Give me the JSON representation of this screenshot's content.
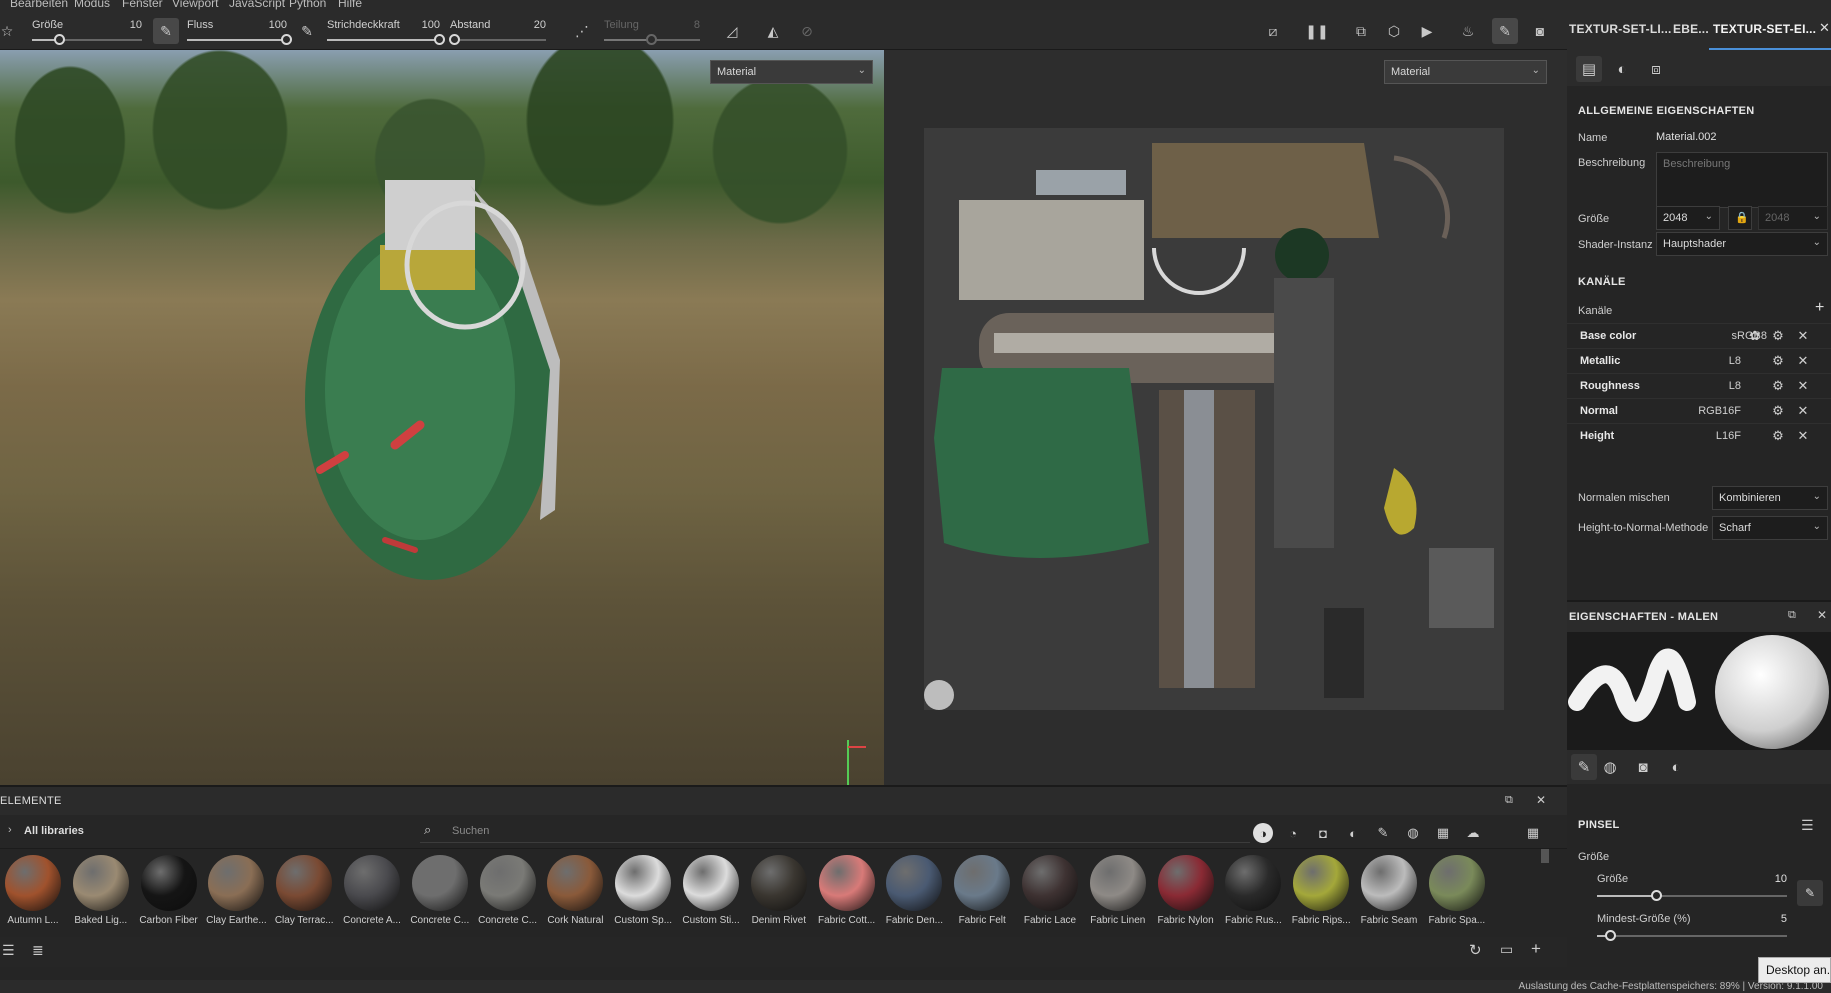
{
  "menu": [
    "Bearbeiten",
    "Modus",
    "Fenster",
    "Viewport",
    "JavaScript",
    "Python",
    "Hilfe"
  ],
  "toolbar": {
    "size": {
      "label": "Größe",
      "value": "10",
      "level": 0.25
    },
    "flow": {
      "label": "Fluss",
      "value": "100",
      "level": 1.0
    },
    "opacity": {
      "label": "Strichdeckkraft",
      "value": "100",
      "level": 1.0
    },
    "spacing": {
      "label": "Abstand",
      "value": "20",
      "level": 0.05
    },
    "division": {
      "label": "Teilung",
      "value": "8",
      "level": 0.5
    }
  },
  "viewport3d": {
    "material_select": "Material"
  },
  "viewport2d": {
    "material_select": "Material"
  },
  "right_panel": {
    "tabs": [
      "TEXTUR-SET-LI...",
      "EBE...",
      "TEXTUR-SET-EI..."
    ],
    "general": {
      "title": "ALLGEMEINE EIGENSCHAFTEN",
      "name_label": "Name",
      "name_value": "Material.002",
      "desc_label": "Beschreibung",
      "desc_placeholder": "Beschreibung",
      "size_label": "Größe",
      "size_value": "2048",
      "size_value2": "2048",
      "shader_label": "Shader-Instanz",
      "shader_value": "Hauptshader"
    },
    "channels": {
      "title": "KANÄLE",
      "label": "Kanäle",
      "rows": [
        {
          "name": "Base color",
          "format": "sRGB8"
        },
        {
          "name": "Metallic",
          "format": "L8"
        },
        {
          "name": "Roughness",
          "format": "L8"
        },
        {
          "name": "Normal",
          "format": "RGB16F"
        },
        {
          "name": "Height",
          "format": "L16F"
        }
      ],
      "normal_mix_label": "Normalen mischen",
      "normal_mix_value": "Kombinieren",
      "h2n_label": "Height-to-Normal-Methode",
      "h2n_value": "Scharf"
    },
    "paint": {
      "title": "EIGENSCHAFTEN - MALEN",
      "brush_title": "PINSEL",
      "size_section": "Größe",
      "size_label": "Größe",
      "size_value": "10",
      "min_label": "Mindest-Größe (%)",
      "min_value": "5"
    }
  },
  "shelf": {
    "title": "ELEMENTE",
    "library": "All libraries",
    "search_placeholder": "Suchen",
    "resources": [
      {
        "name": "Autumn L...",
        "color": "#a0522d"
      },
      {
        "name": "Baked Lig...",
        "color": "#9a8a72"
      },
      {
        "name": "Carbon Fiber",
        "color": "#151515"
      },
      {
        "name": "Clay Earthe...",
        "color": "#8a6e55"
      },
      {
        "name": "Clay Terrac...",
        "color": "#7a4a33"
      },
      {
        "name": "Concrete A...",
        "color": "#4a4a4e"
      },
      {
        "name": "Concrete C...",
        "color": "#6e6e6e"
      },
      {
        "name": "Concrete C...",
        "color": "#7a7a76"
      },
      {
        "name": "Cork Natural",
        "color": "#8a5a3a"
      },
      {
        "name": "Custom Sp...",
        "color": "#dcdcdc"
      },
      {
        "name": "Custom Sti...",
        "color": "#dcdcdc"
      },
      {
        "name": "Denim Rivet",
        "color": "#3a3630"
      },
      {
        "name": "Fabric Cott...",
        "color": "#d87a78"
      },
      {
        "name": "Fabric Den...",
        "color": "#4a5a72"
      },
      {
        "name": "Fabric Felt",
        "color": "#6a7a8a"
      },
      {
        "name": "Fabric Lace",
        "color": "#3e3232"
      },
      {
        "name": "Fabric Linen",
        "color": "#8e8a86"
      },
      {
        "name": "Fabric Nylon",
        "color": "#8a2a34"
      },
      {
        "name": "Fabric Rus...",
        "color": "#2a2a2a"
      },
      {
        "name": "Fabric Rips...",
        "color": "#a4a83a"
      },
      {
        "name": "Fabric Seam",
        "color": "#bcbcbc"
      },
      {
        "name": "Fabric Spa...",
        "color": "#7a8a5a"
      }
    ]
  },
  "status": {
    "text": "Auslastung des Cache-Festplattenspeichers: 89% | Version: 9.1.1.00",
    "tooltip": "Desktop an..."
  }
}
